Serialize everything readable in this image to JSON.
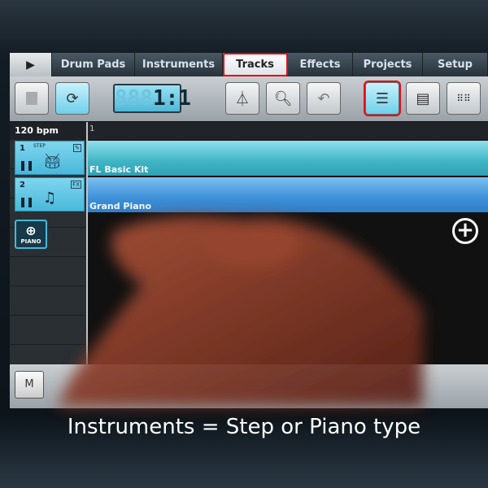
{
  "tabs": [
    {
      "label": "▶"
    },
    {
      "label": "Drum Pads"
    },
    {
      "label": "Instruments"
    },
    {
      "label": "Tracks",
      "active": true
    },
    {
      "label": "Effects"
    },
    {
      "label": "Projects"
    },
    {
      "label": "Setup"
    }
  ],
  "toolbar": {
    "position": "1:1",
    "position_ghost": "888"
  },
  "tempo": "120 bpm",
  "ruler_start": "1",
  "tracks": [
    {
      "number": "1",
      "type": "STEP",
      "name": "FL Basic Kit",
      "icon": "drum-icon",
      "fx": "✎"
    },
    {
      "number": "2",
      "type": "",
      "name": "Grand Piano",
      "icon": "piano-icon",
      "fx": "FX"
    }
  ],
  "add_button": "PIANO",
  "bottom": {
    "mute": "M"
  },
  "caption": "Instruments = Step or Piano type",
  "colors": {
    "highlight": "#e0101a",
    "accent": "#49b8da"
  }
}
